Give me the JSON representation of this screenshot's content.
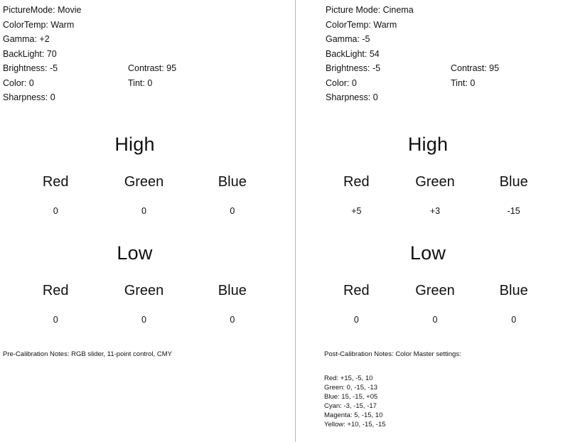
{
  "document": {
    "title": "TV Calibration Settings Sheet"
  },
  "left": {
    "settings": [
      {
        "label": "PictureMode: Movie"
      },
      {
        "label": "ColorTemp: Warm"
      },
      {
        "label": "Gamma: +2"
      },
      {
        "label": "BackLight: 70"
      },
      {
        "label": "Brightness: -5",
        "second": "Contrast: 95"
      },
      {
        "label": "Color: 0",
        "second": "Tint: 0"
      },
      {
        "label": "Sharpness: 0"
      }
    ],
    "white_balance": {
      "high": {
        "title": "High",
        "channels": [
          {
            "name": "Red",
            "value": "0"
          },
          {
            "name": "Green",
            "value": "0"
          },
          {
            "name": "Blue",
            "value": "0"
          }
        ]
      },
      "low": {
        "title": "Low",
        "channels": [
          {
            "name": "Red",
            "value": "0"
          },
          {
            "name": "Green",
            "value": "0"
          },
          {
            "name": "Blue",
            "value": "0"
          }
        ]
      }
    },
    "notes": {
      "heading": "Pre-Calibration Notes: RGB slider, 11-point control, CMY"
    }
  },
  "right": {
    "settings": [
      {
        "label": "Picture Mode: Cinema"
      },
      {
        "label": "ColorTemp: Warm"
      },
      {
        "label": "Gamma: -5"
      },
      {
        "label": "BackLight: 54"
      },
      {
        "label": "Brightness: -5",
        "second": "Contrast: 95"
      },
      {
        "label": "Color: 0",
        "second": "Tint: 0"
      },
      {
        "label": "Sharpness: 0"
      }
    ],
    "white_balance": {
      "high": {
        "title": "High",
        "channels": [
          {
            "name": "Red",
            "value": "+5"
          },
          {
            "name": "Green",
            "value": "+3"
          },
          {
            "name": "Blue",
            "value": "-15"
          }
        ]
      },
      "low": {
        "title": "Low",
        "channels": [
          {
            "name": "Red",
            "value": "0"
          },
          {
            "name": "Green",
            "value": "0"
          },
          {
            "name": "Blue",
            "value": "0"
          }
        ]
      }
    },
    "notes": {
      "heading": "Post-Calibration Notes: Color Master settings:",
      "color_master": [
        "Red: +15, -5, 10",
        "Green: 0, -15, -13",
        "Blue: 15, -15, +05",
        "Cyan: -3, -15, -17",
        "Magenta: 5, -15, 10",
        "Yellow: +10, -15, -15"
      ]
    }
  }
}
